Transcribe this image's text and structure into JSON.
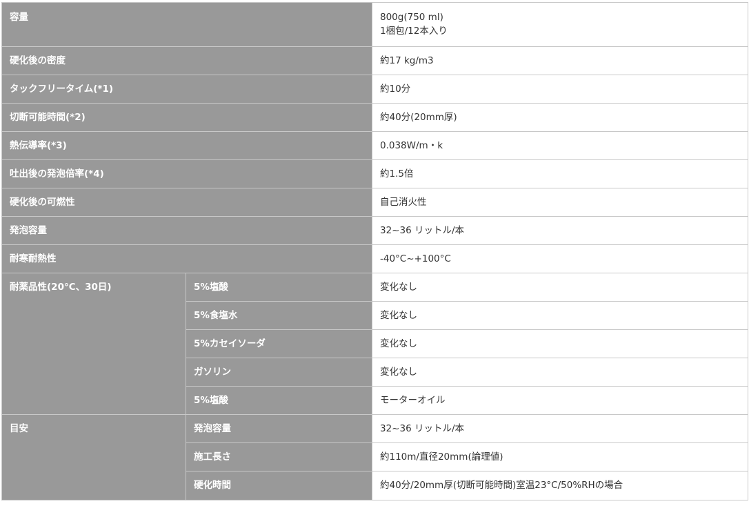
{
  "spec": {
    "capacity": {
      "label": "容量",
      "value_line1": "800g(750 ml)",
      "value_line2": "1梱包/12本入り"
    },
    "rows": [
      {
        "label": "硬化後の密度",
        "value": "約17 kg/m3"
      },
      {
        "label": "タックフリータイム(*1)",
        "value": "約10分"
      },
      {
        "label": "切断可能時間(*2)",
        "value": "約40分(20mm厚)"
      },
      {
        "label": "熱伝導率(*3)",
        "value": "0.038W/m・k"
      },
      {
        "label": "吐出後の発泡倍率(*4)",
        "value": "約1.5倍"
      },
      {
        "label": "硬化後の可燃性",
        "value": "自己消火性"
      },
      {
        "label": "発泡容量",
        "value": "32~36 リットル/本"
      },
      {
        "label": "耐寒耐熱性",
        "value": "-40°C~+100°C"
      }
    ],
    "chemical": {
      "label": "耐薬品性(20°C、30日)",
      "rows": [
        {
          "label": "5%塩酸",
          "value": "変化なし"
        },
        {
          "label": "5%食塩水",
          "value": "変化なし"
        },
        {
          "label": "5%カセイソーダ",
          "value": "変化なし"
        },
        {
          "label": "ガソリン",
          "value": "変化なし"
        },
        {
          "label": "5%塩酸",
          "value": "モーターオイル"
        }
      ]
    },
    "guide": {
      "label": "目安",
      "rows": [
        {
          "label": "発泡容量",
          "value": "32~36 リットル/本"
        },
        {
          "label": "施工長さ",
          "value": "約110m/直径20mm(論理値)"
        },
        {
          "label": "硬化時間",
          "value": "約40分/20mm厚(切断可能時間)室温23°C/50%RHの場合"
        }
      ]
    }
  }
}
